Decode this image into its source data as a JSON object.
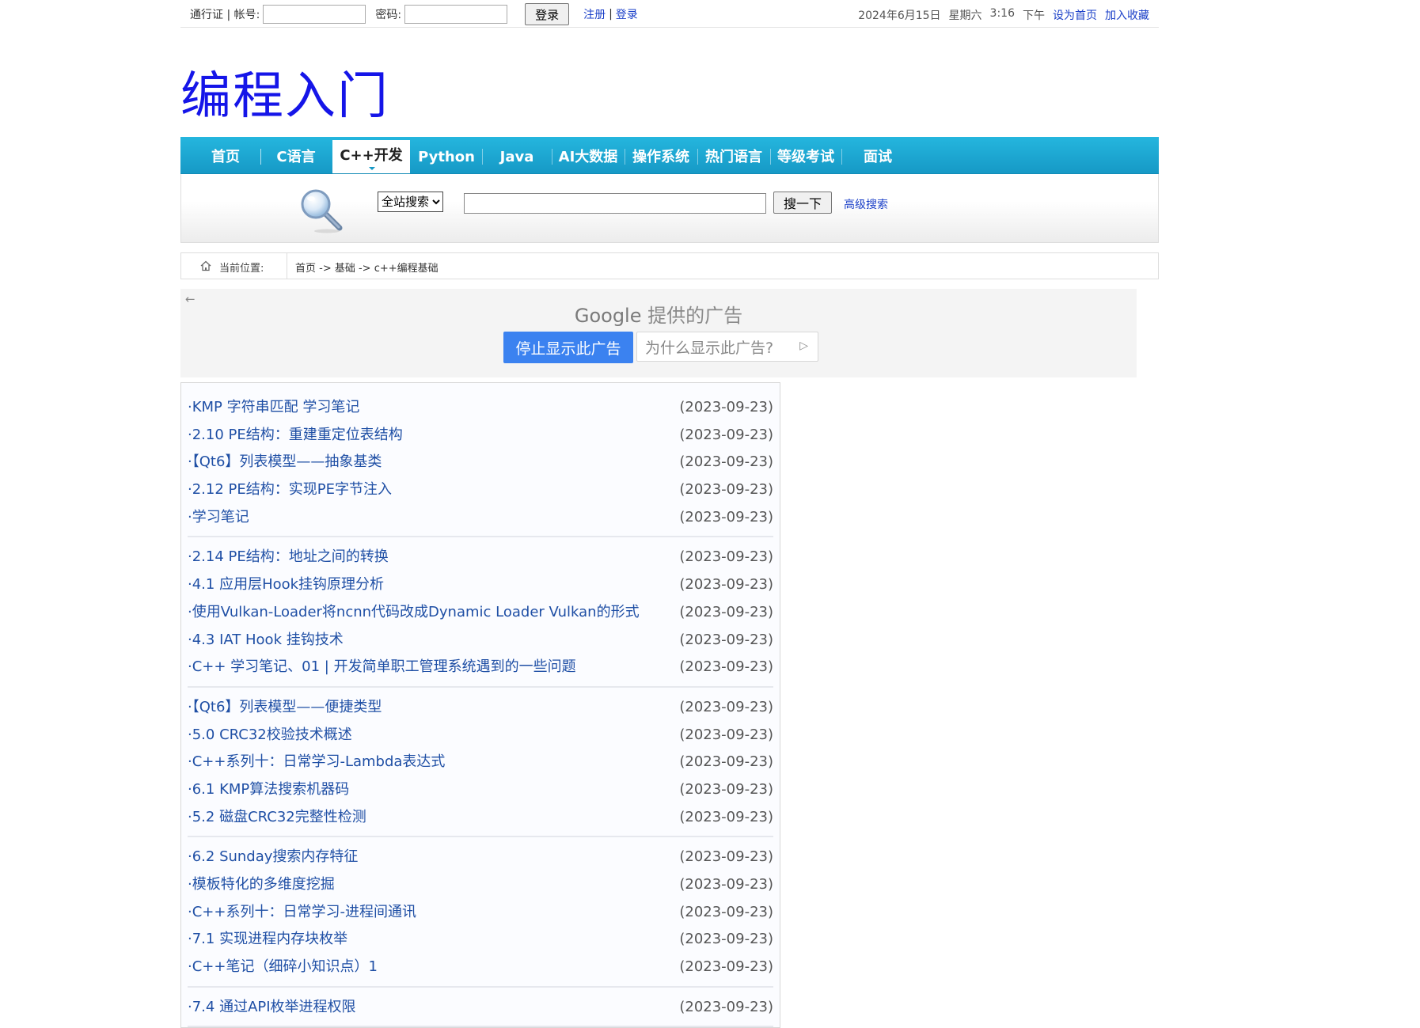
{
  "topbar": {
    "pass_label": "通行证 | 帐号:",
    "password_label": "密码:",
    "login_button": "登录",
    "register_link": "注册",
    "separator": "|",
    "login_link": "登录",
    "date_text": "2024年6月15日",
    "weekday_text": "星期六",
    "time_text": "3:16",
    "ampm_text": "下午",
    "set_home_link": "设为首页",
    "favorite_link": "加入收藏"
  },
  "logo": {
    "title": "编程入门"
  },
  "nav": {
    "items": [
      {
        "label": "首页"
      },
      {
        "label": "C语言"
      },
      {
        "label": "C++开发"
      },
      {
        "label": "Python"
      },
      {
        "label": "Java"
      },
      {
        "label": "AI大数据"
      },
      {
        "label": "操作系统"
      },
      {
        "label": "热门语言"
      },
      {
        "label": "等级考试"
      },
      {
        "label": "面试"
      }
    ],
    "active_index": 2
  },
  "search": {
    "scope_selected": "全站搜索",
    "keyword_value": "",
    "button_label": "搜一下",
    "advanced_link": "高级搜索"
  },
  "breadcrumb": {
    "label": "当前位置:",
    "path": "首页 -> 基础 -> c++编程基础"
  },
  "ad": {
    "brand": "Google",
    "provided": "提供的广告",
    "stop_button": "停止显示此广告",
    "why_button": "为什么显示此广告?"
  },
  "articles": {
    "groups": [
      [
        {
          "title": "·KMP 字符串匹配 学习笔记",
          "date": "(2023-09-23)"
        },
        {
          "title": "·2.10 PE结构：重建重定位表结构",
          "date": "(2023-09-23)"
        },
        {
          "title": "·【Qt6】列表模型——抽象基类",
          "date": "(2023-09-23)"
        },
        {
          "title": "·2.12 PE结构：实现PE字节注入",
          "date": "(2023-09-23)"
        },
        {
          "title": "·学习笔记",
          "date": "(2023-09-23)"
        }
      ],
      [
        {
          "title": "·2.14 PE结构：地址之间的转换",
          "date": "(2023-09-23)"
        },
        {
          "title": "·4.1 应用层Hook挂钩原理分析",
          "date": "(2023-09-23)"
        },
        {
          "title": "·使用Vulkan-Loader将ncnn代码改成Dynamic Loader Vulkan的形式",
          "date": "(2023-09-23)"
        },
        {
          "title": "·4.3 IAT Hook 挂钩技术",
          "date": "(2023-09-23)"
        },
        {
          "title": "·C++ 学习笔记、01 | 开发简单职工管理系统遇到的一些问题",
          "date": "(2023-09-23)"
        }
      ],
      [
        {
          "title": "·【Qt6】列表模型——便捷类型",
          "date": "(2023-09-23)"
        },
        {
          "title": "·5.0 CRC32校验技术概述",
          "date": "(2023-09-23)"
        },
        {
          "title": "·C++系列十：日常学习-Lambda表达式",
          "date": "(2023-09-23)"
        },
        {
          "title": "·6.1 KMP算法搜索机器码",
          "date": "(2023-09-23)"
        },
        {
          "title": "·5.2 磁盘CRC32完整性检测",
          "date": "(2023-09-23)"
        }
      ],
      [
        {
          "title": "·6.2 Sunday搜索内存特征",
          "date": "(2023-09-23)"
        },
        {
          "title": "·模板特化的多维度挖掘",
          "date": "(2023-09-23)"
        },
        {
          "title": "·C++系列十：日常学习-进程间通讯",
          "date": "(2023-09-23)"
        },
        {
          "title": "·7.1 实现进程内存块枚举",
          "date": "(2023-09-23)"
        },
        {
          "title": "·C++笔记（细碎小知识点）1",
          "date": "(2023-09-23)"
        }
      ],
      [
        {
          "title": "·7.4 通过API枚举进程权限",
          "date": "(2023-09-23)"
        }
      ]
    ]
  }
}
